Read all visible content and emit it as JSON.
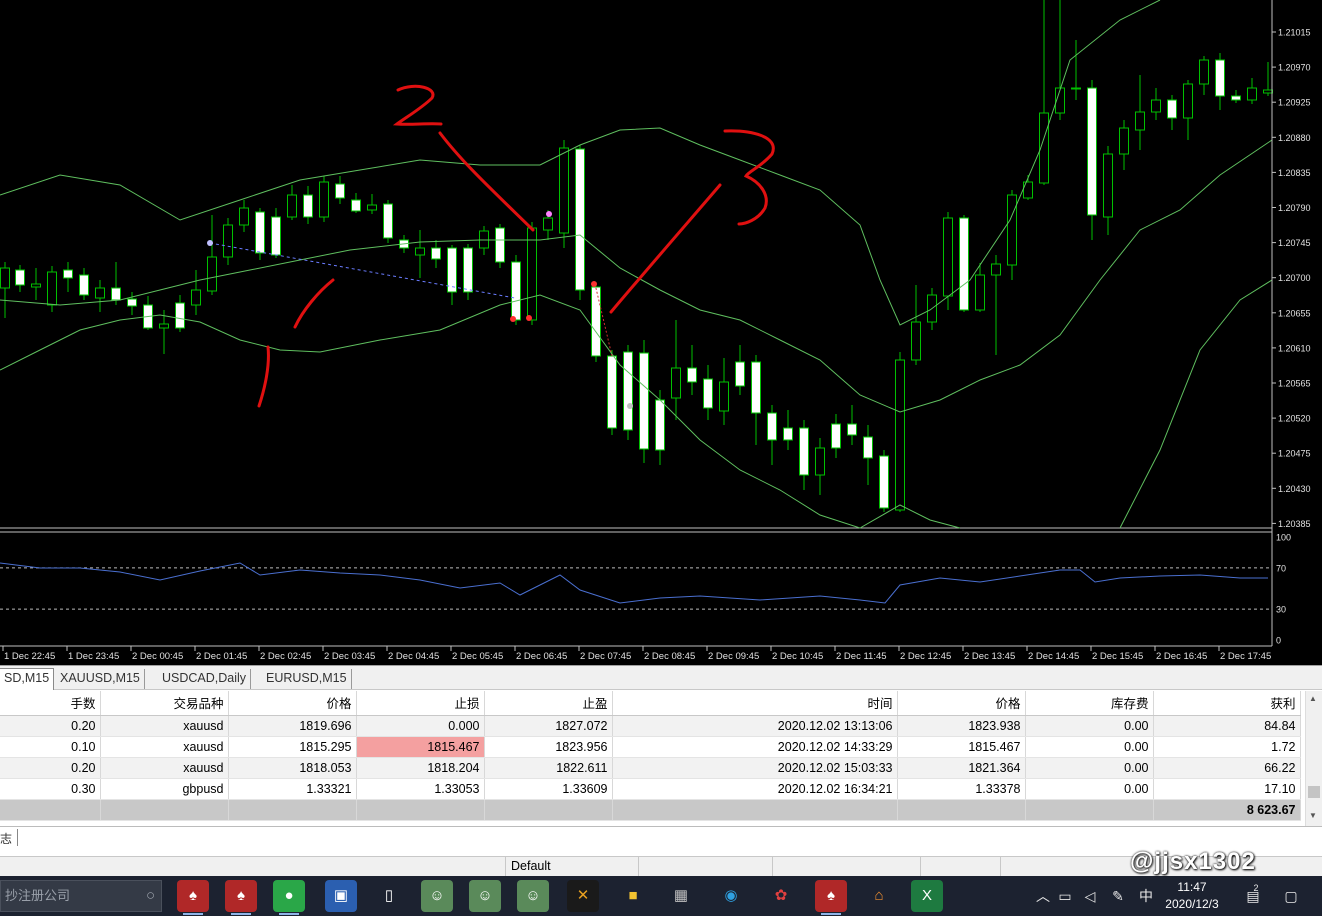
{
  "chart": {
    "symbol_timeframe": "EURUSD,M15",
    "price_levels": [
      "1.21015",
      "1.20970",
      "1.20925",
      "1.20880",
      "1.20835",
      "1.20790",
      "1.20745",
      "1.20700",
      "1.20655",
      "1.20610",
      "1.20565",
      "1.20520",
      "1.20475",
      "1.20430",
      "1.20385"
    ],
    "rsi_levels": [
      "100",
      "70",
      "30",
      "0"
    ],
    "time_labels": [
      "1 Dec 22:45",
      "1 Dec 23:45",
      "2 Dec 00:45",
      "2 Dec 01:45",
      "2 Dec 02:45",
      "2 Dec 03:45",
      "2 Dec 04:45",
      "2 Dec 05:45",
      "2 Dec 06:45",
      "2 Dec 07:45",
      "2 Dec 08:45",
      "2 Dec 09:45",
      "2 Dec 10:45",
      "2 Dec 11:45",
      "2 Dec 12:45",
      "2 Dec 13:45",
      "2 Dec 14:45",
      "2 Dec 15:45",
      "2 Dec 16:45",
      "2 Dec 17:45"
    ],
    "colors": {
      "background": "#000000",
      "candle_bull": "#000000",
      "candle_bear": "#ffffff",
      "wick": "#00c000",
      "bands": "#5fbf5f",
      "rsi": "#4a6fd0",
      "annotation": "#e01010"
    },
    "annotations": [
      "1",
      "2",
      "3"
    ]
  },
  "tabs": [
    {
      "label": "SD,M15",
      "active": true
    },
    {
      "label": "XAUUSD,M15",
      "active": false
    },
    {
      "label": "USDCAD,Daily",
      "active": false
    },
    {
      "label": "EURUSD,M15",
      "active": false
    }
  ],
  "orders": {
    "headers": [
      "手数",
      "交易品种",
      "价格",
      "止损",
      "止盈",
      "时间",
      "价格",
      "库存费",
      "获利"
    ],
    "rows": [
      [
        "0.20",
        "xauusd",
        "1819.696",
        "0.000",
        "1827.072",
        "2020.12.02 13:13:06",
        "1823.938",
        "0.00",
        "84.84"
      ],
      [
        "0.10",
        "xauusd",
        "1815.295",
        "1815.467",
        "1823.956",
        "2020.12.02 14:33:29",
        "1815.467",
        "0.00",
        "1.72"
      ],
      [
        "0.20",
        "xauusd",
        "1818.053",
        "1818.204",
        "1822.611",
        "2020.12.02 15:03:33",
        "1821.364",
        "0.00",
        "66.22"
      ],
      [
        "0.30",
        "gbpusd",
        "1.33321",
        "1.33053",
        "1.33609",
        "2020.12.02 16:34:21",
        "1.33378",
        "0.00",
        "17.10"
      ]
    ],
    "total": "8 623.67"
  },
  "log_tab": "志",
  "status": {
    "profile": "Default"
  },
  "taskbar": {
    "search_placeholder": "抄注册公司",
    "tray_ime": "中",
    "time": "11:47",
    "date": "2020/12/3",
    "notifications": "2"
  },
  "watermark": "@jjsx1302"
}
